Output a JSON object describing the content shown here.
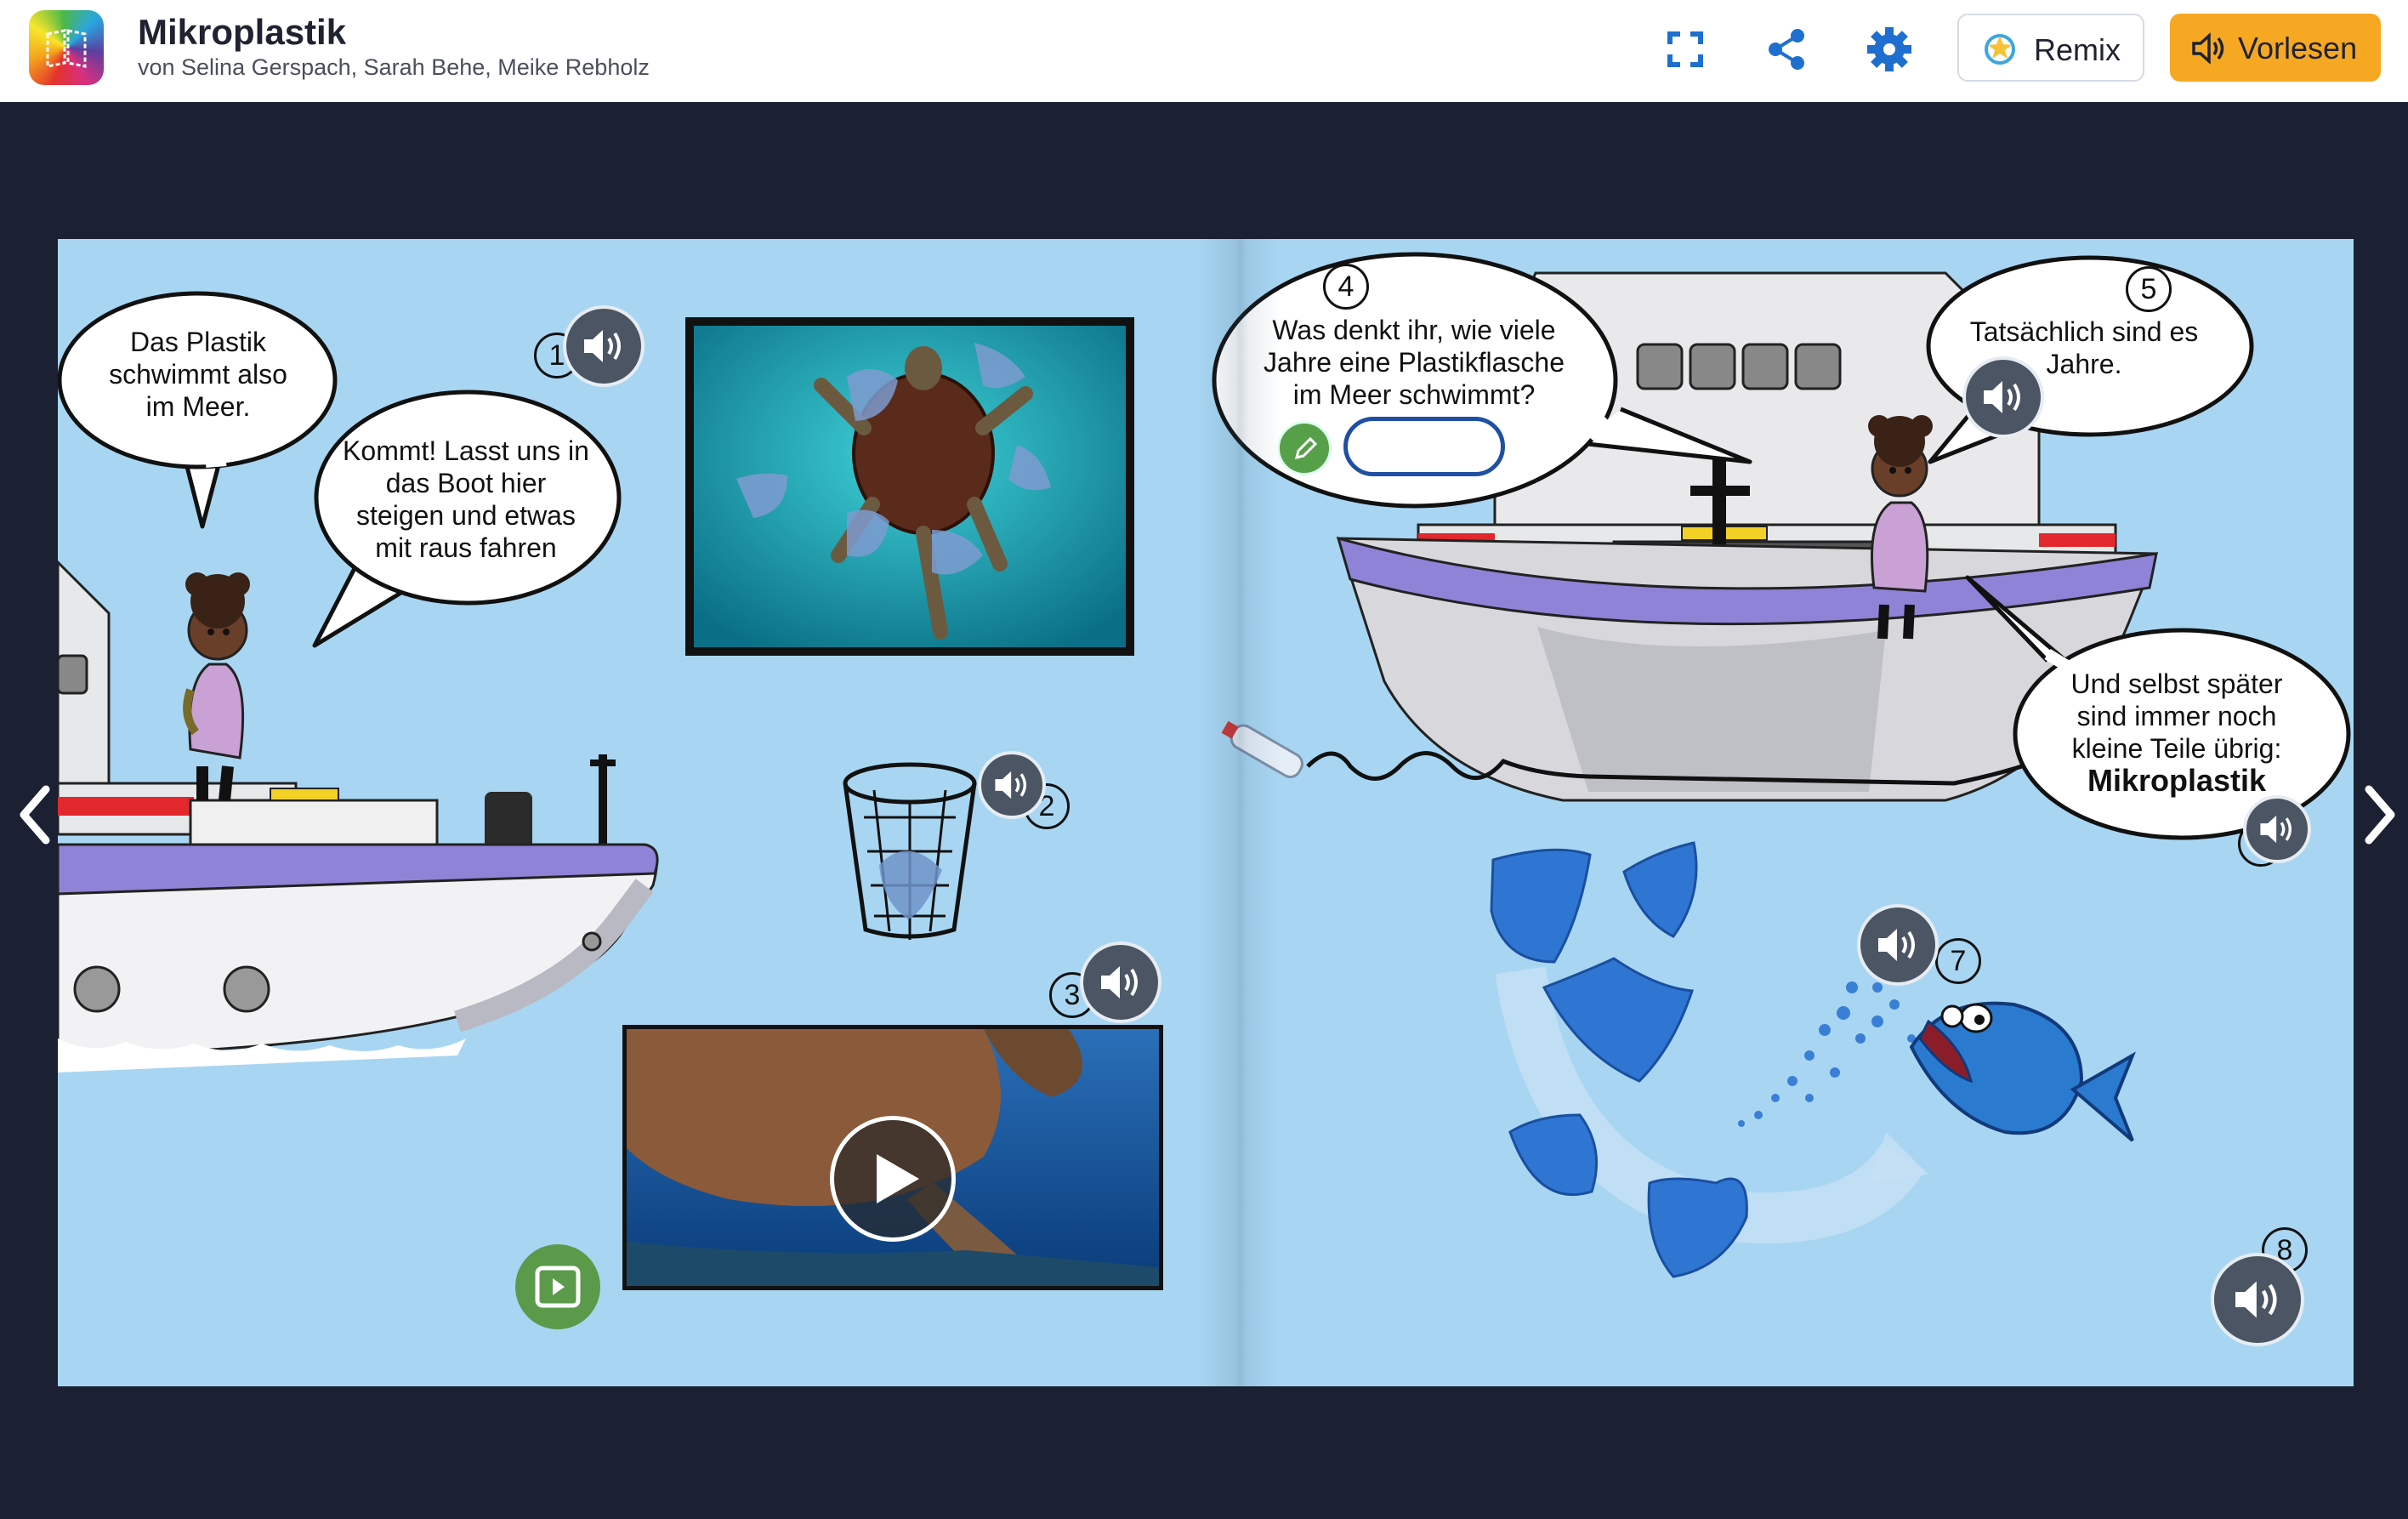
{
  "app": {
    "title": "Mikroplastik",
    "authors": "von Selina Gerspach, Sarah Behe, Meike Rebholz"
  },
  "toolbar": {
    "fullscreen_icon": "fullscreen-icon",
    "share_icon": "share-icon",
    "settings_icon": "gear-icon",
    "remix_label": "Remix",
    "read_aloud_label": "Vorlesen"
  },
  "colors": {
    "page_bg": "#1b2032",
    "book_bg": "#a8d6f2",
    "accent_orange": "#f6a823",
    "input_border": "#1e4fa3"
  },
  "book": {
    "left_page": {
      "bubble_1": "Das Plastik schwimmt also im Meer.",
      "bubble_2": "Kommt! Lasst uns in das Boot hier steigen und etwas mit raus fahren",
      "audio_numbers": [
        "1",
        "2",
        "3"
      ]
    },
    "right_page": {
      "bubble_4": "Was denkt ihr, wie viele Jahre eine Plastikflasche im Meer schwimmt?",
      "bubble_5": "Tatsächlich sind es Jahre.",
      "bubble_6_line": "Und selbst später sind immer noch kleine Teile übrig:",
      "bubble_6_bold": "Mikroplastik",
      "audio_numbers": [
        "4",
        "5",
        "6",
        "7",
        "8"
      ],
      "answer_value": ""
    }
  }
}
